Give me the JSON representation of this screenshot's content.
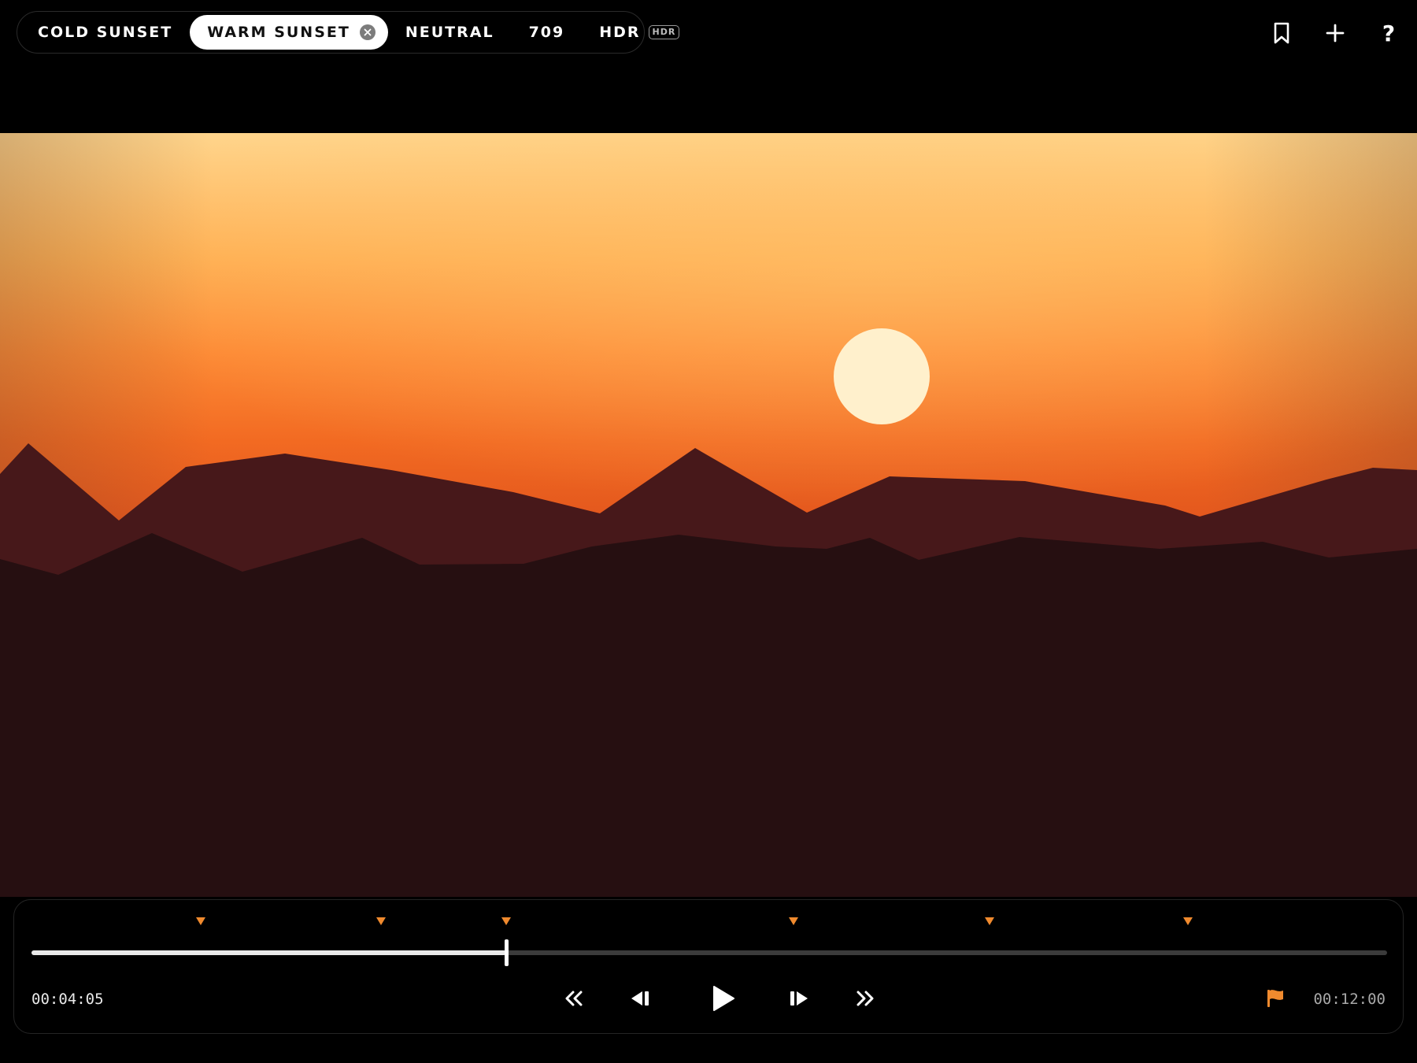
{
  "presets": [
    {
      "label": "COLD SUNSET",
      "active": false
    },
    {
      "label": "WARM SUNSET",
      "active": true
    },
    {
      "label": "NEUTRAL",
      "active": false
    },
    {
      "label": "709",
      "active": false
    },
    {
      "label": "HDR",
      "active": false,
      "badge": "HDR"
    }
  ],
  "toolbar": {
    "icons": [
      "bookmark-icon",
      "plus-icon",
      "help-icon"
    ],
    "help_label": "?"
  },
  "player": {
    "current_time": "00:04:05",
    "total_time": "00:12:00",
    "progress": 0.35,
    "marker_positions": [
      0.125,
      0.258,
      0.35,
      0.562,
      0.707,
      0.853
    ],
    "marker_color": "#f08a2e",
    "transport_icons": [
      "rewind-icon",
      "step-back-icon",
      "play-icon",
      "step-forward-icon",
      "fast-forward-icon"
    ],
    "flag_icon": "flag-icon",
    "flag_color": "#f08a2e"
  }
}
